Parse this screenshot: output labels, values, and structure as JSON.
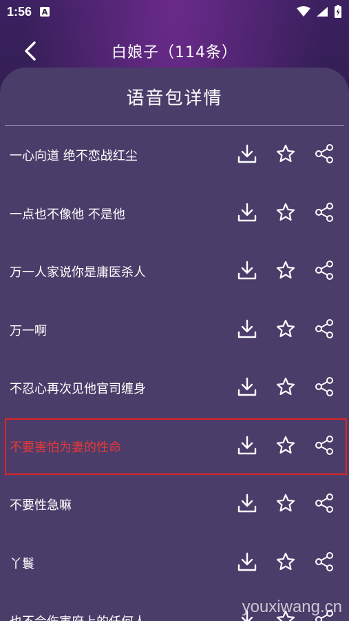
{
  "status_bar": {
    "time": "1:56",
    "badge": "A"
  },
  "header": {
    "title": "白娘子（114条）"
  },
  "panel": {
    "title": "语音包详情"
  },
  "items": [
    {
      "label": "一心向道 绝不恋战红尘"
    },
    {
      "label": "一点也不像他 不是他"
    },
    {
      "label": "万一人家说你是庸医杀人"
    },
    {
      "label": "万一啊"
    },
    {
      "label": "不忍心再次见他官司缠身"
    },
    {
      "label": "不要害怕为妻的性命",
      "selected": true
    },
    {
      "label": "不要性急嘛"
    },
    {
      "label": "丫鬟"
    },
    {
      "label": "也不会伤害府上的任何人"
    }
  ],
  "watermark": "youxiwang.cn",
  "colors": {
    "panel": "#4b3d6a",
    "selected_text": "#e53935",
    "selected_border": "#e02424"
  }
}
